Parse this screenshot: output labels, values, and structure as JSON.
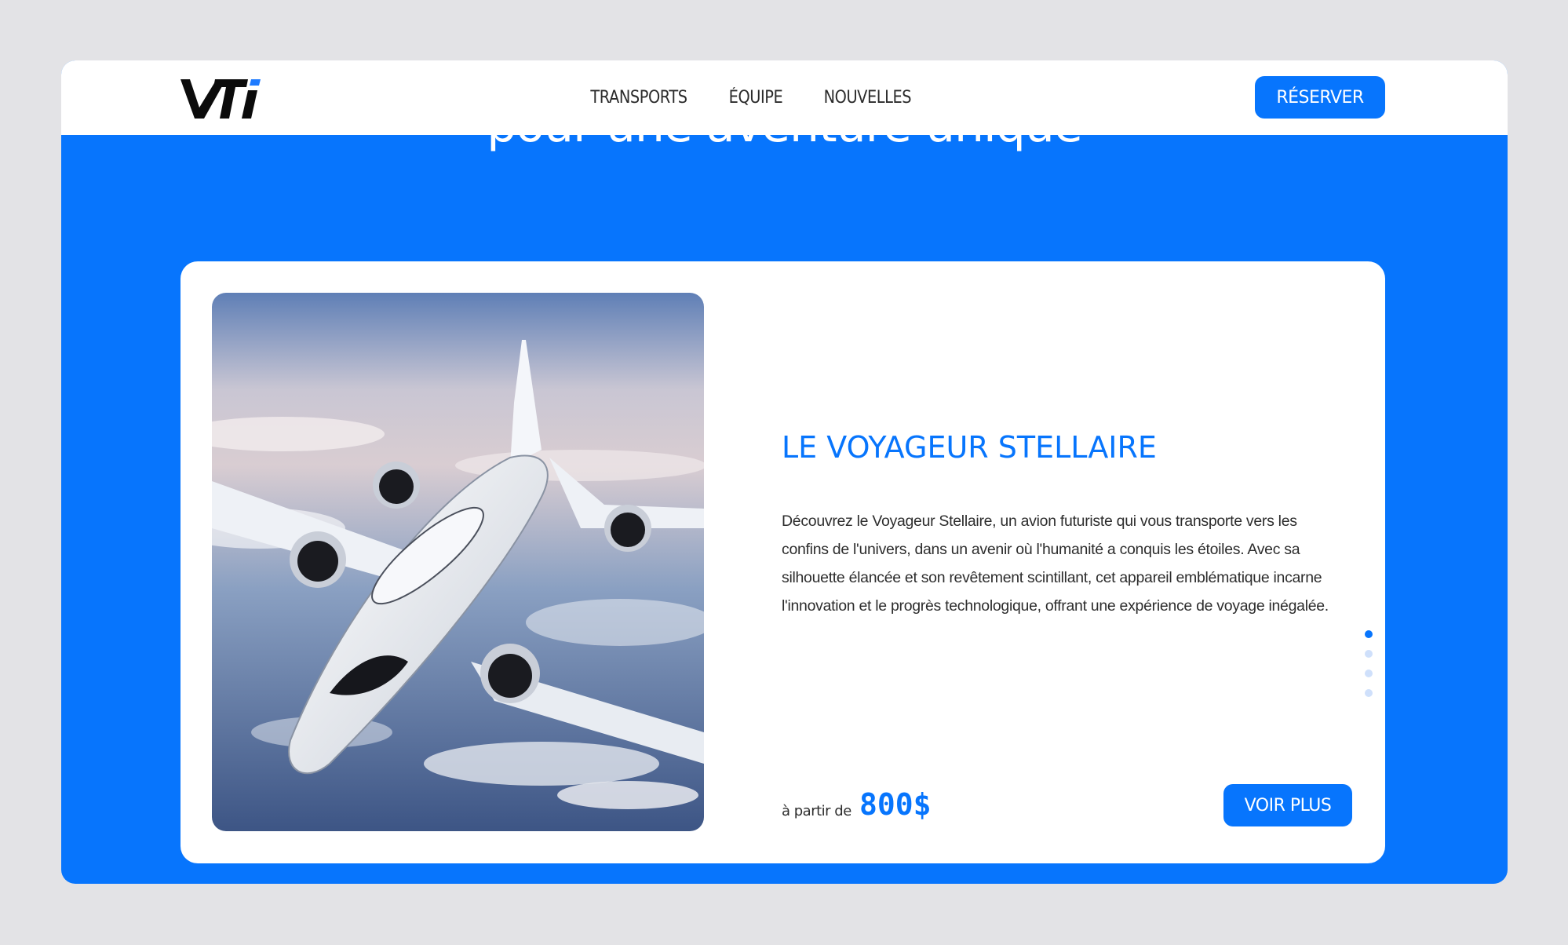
{
  "brand": {
    "logo_text": "VTi",
    "accent_color": "#0775fd"
  },
  "nav": {
    "links": [
      {
        "label": "TRANSPORTS"
      },
      {
        "label": "ÉQUIPE"
      },
      {
        "label": "NOUVELLES"
      }
    ],
    "reserve_label": "RÉSERVER"
  },
  "hero": {
    "heading": "pour une aventure unique"
  },
  "card": {
    "image_icon": "airplane-photo",
    "title": "LE VOYAGEUR STELLAIRE",
    "description": "Découvrez le Voyageur Stellaire, un avion futuriste qui vous transporte vers les confins de l'univers, dans un avenir où l'humanité a conquis les étoiles. Avec sa silhouette élancée et son revêtement scintillant, cet appareil emblématique incarne l'innovation et le progrès technologique, offrant une expérience de voyage inégalée.",
    "price_prefix": "à partir de",
    "price": "800$",
    "cta_label": "VOIR PLUS"
  },
  "carousel": {
    "count": 4,
    "active_index": 0
  }
}
